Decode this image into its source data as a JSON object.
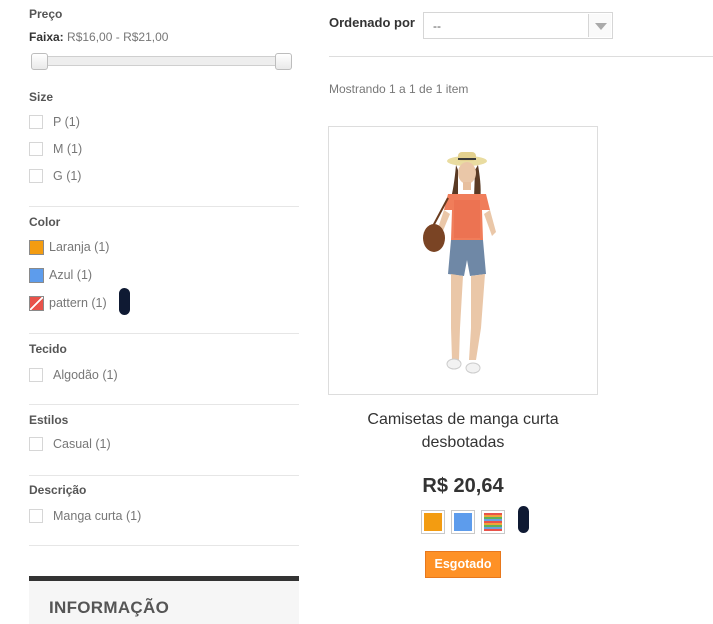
{
  "filters": {
    "price": {
      "title": "Preço",
      "range_label": "Faixa:",
      "range_value": "R$16,00 - R$21,00",
      "slider_min_fraction": 0.0,
      "slider_max_fraction": 1.0
    },
    "size": {
      "title": "Size",
      "options": [
        {
          "label": "P (1)",
          "checked": false
        },
        {
          "label": "M (1)",
          "checked": false
        },
        {
          "label": "G (1)",
          "checked": false
        }
      ]
    },
    "color": {
      "title": "Color",
      "options": [
        {
          "label": "Laranja (1)",
          "color": "#f39c11"
        },
        {
          "label": "Azul (1)",
          "color": "#5d9cec"
        },
        {
          "label": "pattern (1)",
          "color": "pattern"
        }
      ]
    },
    "fabric": {
      "title": "Tecido",
      "options": [
        {
          "label": "Algodão (1)",
          "checked": false
        }
      ]
    },
    "style": {
      "title": "Estilos",
      "options": [
        {
          "label": "Casual (1)",
          "checked": false
        }
      ]
    },
    "description": {
      "title": "Descrição",
      "options": [
        {
          "label": "Manga curta (1)",
          "checked": false
        }
      ]
    }
  },
  "info_box": {
    "title": "INFORMAÇÃO"
  },
  "sort": {
    "label": "Ordenado por",
    "selected": "--"
  },
  "showing": "Mostrando 1 a 1 de 1 item",
  "product": {
    "name": "Camisetas de manga curta desbotadas",
    "price": "R$ 20,64",
    "swatches": [
      "#f39c11",
      "#5d9cec",
      "pattern"
    ],
    "status_button": "Esgotado"
  },
  "colors": {
    "accent_orange": "#fe9126",
    "swatch_orange": "#f39c11",
    "swatch_blue": "#5d9cec",
    "info_border": "#333333"
  }
}
